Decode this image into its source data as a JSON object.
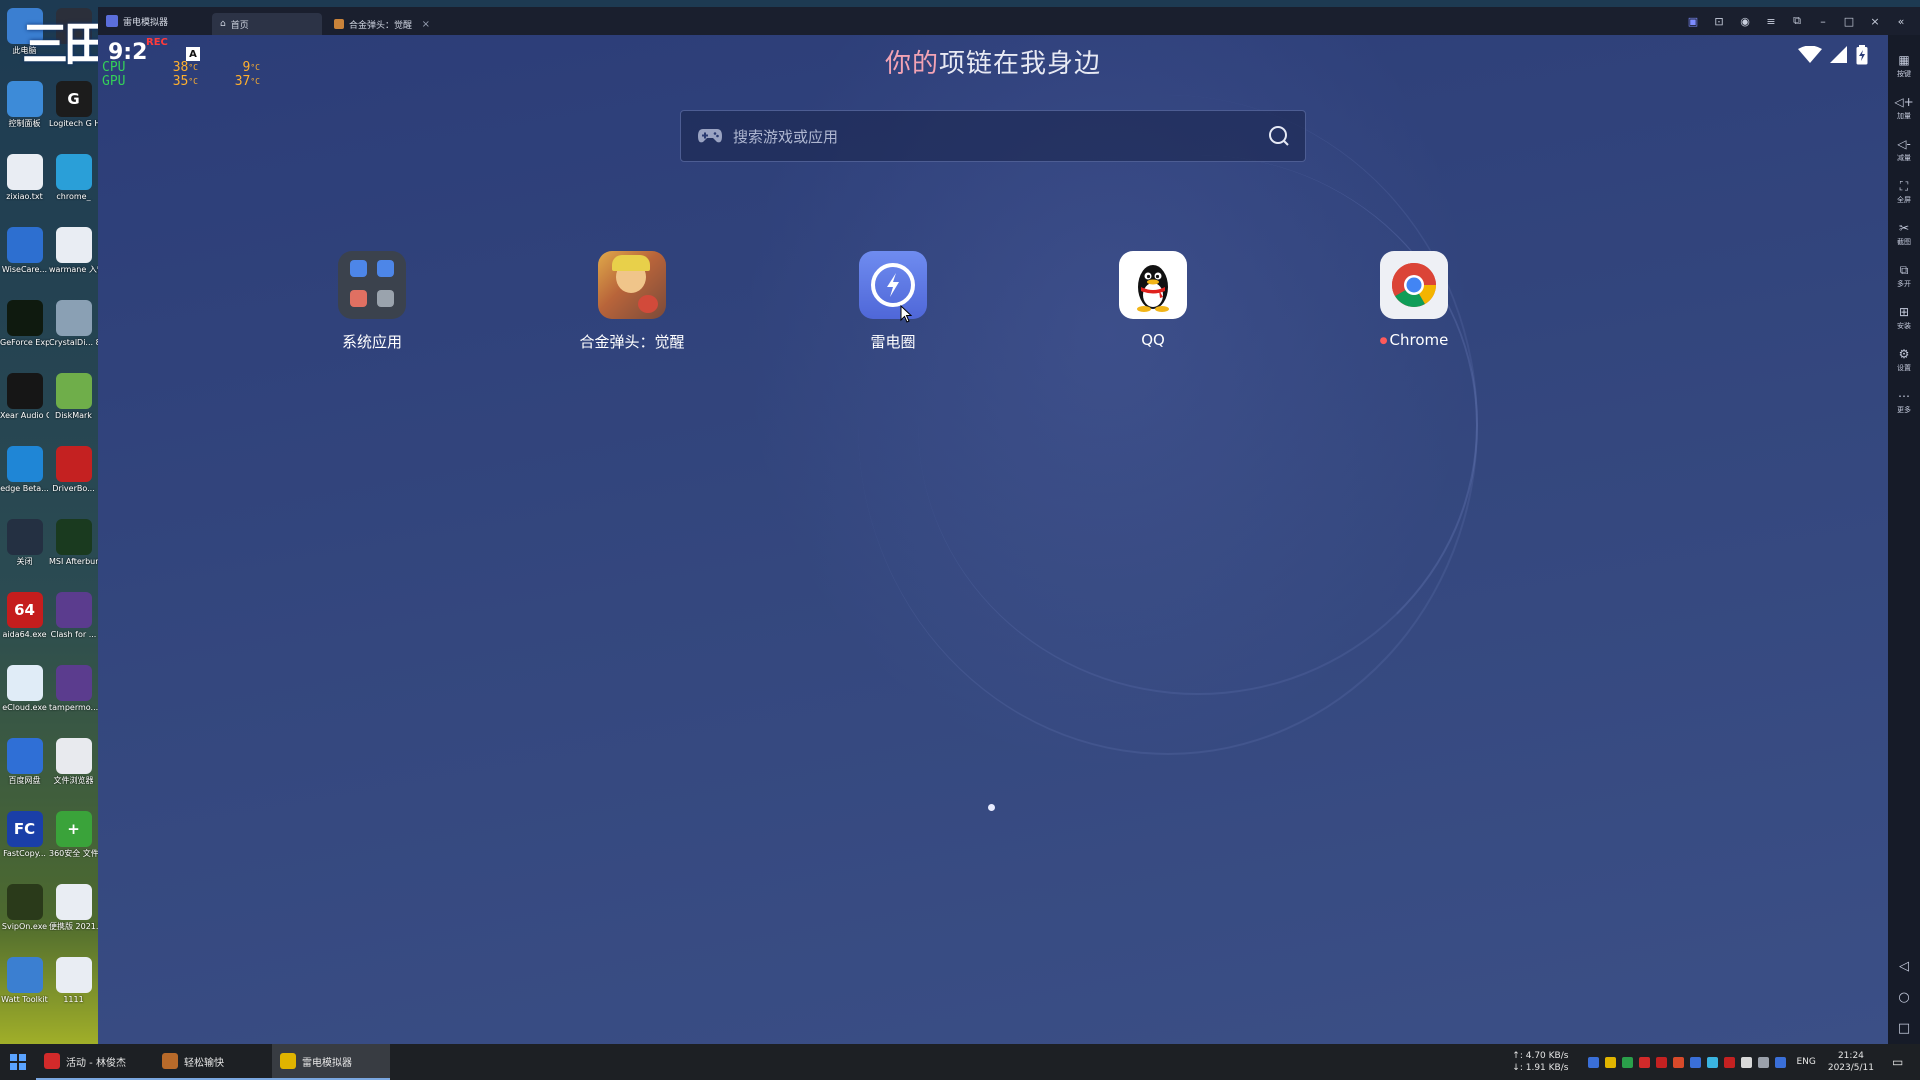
{
  "desktop": {
    "logo_text": "三田",
    "icons": [
      {
        "label": "此电脑",
        "glyph": "",
        "color": "#3b7fd1"
      },
      {
        "label": "",
        "glyph": "",
        "color": "#2b2f3a"
      },
      {
        "label": "控制面板",
        "glyph": "",
        "color": "#3d8bd8"
      },
      {
        "label": "Logitech G HUB",
        "glyph": "G",
        "color": "#1c1c1c"
      },
      {
        "label": "zixiao.txt",
        "glyph": "",
        "color": "#e9edf3"
      },
      {
        "label": "chrome_",
        "glyph": "",
        "color": "#2a9fd8"
      },
      {
        "label": "WiseCare...",
        "glyph": "",
        "color": "#2d6fd0"
      },
      {
        "label": "warmane 入营游戏",
        "glyph": "",
        "color": "#e9edf3"
      },
      {
        "label": "GeForce Experience",
        "glyph": "",
        "color": "#0f1a0f"
      },
      {
        "label": "CrystalDi... 8.17.14.4",
        "glyph": "",
        "color": "#8aa0b4"
      },
      {
        "label": "Xear Audio Center",
        "glyph": "",
        "color": "#161616"
      },
      {
        "label": "DiskMark",
        "glyph": "",
        "color": "#6fae4a"
      },
      {
        "label": "edge Beta...",
        "glyph": "",
        "color": "#1f86d6"
      },
      {
        "label": "DriverBo...",
        "glyph": "",
        "color": "#c42121"
      },
      {
        "label": "关闭",
        "glyph": "",
        "color": "#243042"
      },
      {
        "label": "MSI Afterburner",
        "glyph": "",
        "color": "#1a3a1f"
      },
      {
        "label": "aida64.exe",
        "glyph": "64",
        "color": "#c51d1d"
      },
      {
        "label": "Clash for ...",
        "glyph": "",
        "color": "#5b3c8e"
      },
      {
        "label": "eCloud.exe",
        "glyph": "",
        "color": "#e0ecf7"
      },
      {
        "label": "tampermo...",
        "glyph": "",
        "color": "#5b3c8e"
      },
      {
        "label": "百度网盘",
        "glyph": "",
        "color": "#2f6fd6"
      },
      {
        "label": "文件浏览器",
        "glyph": "",
        "color": "#e8eaee"
      },
      {
        "label": "FastCopy...",
        "glyph": "FC",
        "color": "#1a3fa8"
      },
      {
        "label": "360安全 文件粉碎",
        "glyph": "+",
        "color": "#3aa33a"
      },
      {
        "label": "SvipOn.exe",
        "glyph": "",
        "color": "#2a3a1a"
      },
      {
        "label": "便携版 2021.txt",
        "glyph": "",
        "color": "#e9edf3"
      },
      {
        "label": "Watt Toolkit",
        "glyph": "",
        "color": "#3b7fd1"
      },
      {
        "label": "1111",
        "glyph": "",
        "color": "#e9edf3"
      }
    ]
  },
  "window": {
    "app_name": "雷电模拟器",
    "tabs": [
      {
        "label": "首页",
        "icon": "home-icon",
        "active": true
      },
      {
        "label": "合金弹头：觉醒",
        "icon": "game-icon",
        "active": false,
        "close": "×"
      }
    ],
    "controls": {
      "minimize": "–",
      "maximize": "□",
      "close": "×",
      "collapse": "«"
    }
  },
  "statusbar": {
    "time": "9:2",
    "rec": "REC",
    "keyboard_indicator": "A",
    "hw_rows": [
      {
        "label": "CPU",
        "v1": "38",
        "v2": "9"
      },
      {
        "label": "GPU",
        "v1": "35",
        "v2": "37"
      }
    ],
    "unit": "°C"
  },
  "home": {
    "headline_accent": "你的",
    "headline_rest": "项链在我身边",
    "search_placeholder": "搜索游戏或应用",
    "apps": [
      {
        "label": "系统应用",
        "icon": "system-apps-folder-icon"
      },
      {
        "label": "合金弹头：觉醒",
        "icon": "metal-slug-awakening-icon"
      },
      {
        "label": "雷电圈",
        "icon": "leidian-circle-icon"
      },
      {
        "label": "QQ",
        "icon": "qq-penguin-icon"
      },
      {
        "label": "Chrome",
        "icon": "chrome-icon",
        "new_dot": "●"
      }
    ]
  },
  "sidebar": {
    "tools": [
      {
        "label": "按键",
        "glyph": "▦"
      },
      {
        "label": "加量",
        "glyph": "◁+"
      },
      {
        "label": "减量",
        "glyph": "◁-"
      },
      {
        "label": "全屏",
        "glyph": "⛶"
      },
      {
        "label": "截图",
        "glyph": "✂"
      },
      {
        "label": "多开",
        "glyph": "⧉"
      },
      {
        "label": "安装",
        "glyph": "⊞"
      },
      {
        "label": "设置",
        "glyph": "⚙"
      },
      {
        "label": "更多",
        "glyph": "⋯"
      }
    ],
    "nav": {
      "back": "◁",
      "home": "○",
      "recent": "□"
    }
  },
  "taskbar": {
    "tasks": [
      {
        "label": "活动 - 林俊杰",
        "color": "#d22a2a",
        "state": "open"
      },
      {
        "label": "轻松输快",
        "color": "#b86a2a",
        "state": "open"
      },
      {
        "label": "雷电模拟器",
        "color": "#e0b400",
        "state": "focus"
      }
    ],
    "net_up": "↑: 4.70 KB/s",
    "net_down": "↓: 1.91 KB/s",
    "tray_colors": [
      "#3a6fd8",
      "#e0b400",
      "#2a9f4a",
      "#d22a2a",
      "#c42121",
      "#d84a2a",
      "#3a6fd8",
      "#3ab4e0",
      "#c42121",
      "#d8d8d8",
      "#9aa0aa",
      "#3a6fd8"
    ],
    "lang": "ENG",
    "time": "21:24",
    "date": "2023/5/11",
    "notification": "▭"
  }
}
